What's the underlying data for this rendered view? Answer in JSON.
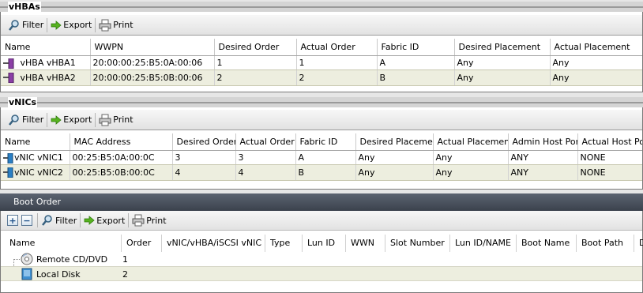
{
  "vhbas": {
    "title": "vHBAs",
    "toolbar": {
      "filter": "Filter",
      "export": "Export",
      "print": "Print"
    },
    "columns": [
      "Name",
      "WWPN",
      "Desired Order",
      "Actual Order",
      "Fabric ID",
      "Desired Placement",
      "Actual Placement"
    ],
    "rows": [
      [
        "vHBA vHBA1",
        "20:00:00:25:B5:0A:00:06",
        "1",
        "1",
        "A",
        "Any",
        "Any"
      ],
      [
        "vHBA vHBA2",
        "20:00:00:25:B5:0B:00:06",
        "2",
        "2",
        "B",
        "Any",
        "Any"
      ]
    ]
  },
  "vnics": {
    "title": "vNICs",
    "toolbar": {
      "filter": "Filter",
      "export": "Export",
      "print": "Print"
    },
    "columns": [
      "Name",
      "MAC Address",
      "Desired Order",
      "Actual Order",
      "Fabric ID",
      "Desired Placement",
      "Actual Placement",
      "Admin Host Port",
      "Actual Host Por"
    ],
    "rows": [
      [
        "vNIC vNIC1",
        "00:25:B5:0A:00:0C",
        "3",
        "3",
        "A",
        "Any",
        "Any",
        "ANY",
        "NONE"
      ],
      [
        "vNIC vNIC2",
        "00:25:B5:0B:00:0C",
        "4",
        "4",
        "B",
        "Any",
        "Any",
        "ANY",
        "NONE"
      ]
    ]
  },
  "boot_order": {
    "title": "Boot Order",
    "toolbar": {
      "add": "+",
      "remove": "−",
      "filter": "Filter",
      "export": "Export",
      "print": "Print"
    },
    "columns": [
      "Name",
      "Order",
      "vNIC/vHBA/iSCSI vNIC",
      "Type",
      "Lun ID",
      "WWN",
      "Slot Number",
      "Lun ID/NAME",
      "Boot Name",
      "Boot Path",
      "D"
    ],
    "rows": [
      {
        "name": "Remote CD/DVD",
        "order": "1",
        "icon": "cd-dvd-icon"
      },
      {
        "name": "Local Disk",
        "order": "2",
        "icon": "local-disk-icon"
      }
    ]
  },
  "colors": {
    "row_alt": "#edeedf",
    "boot_header": "#4a525e",
    "hba_icon": "#8b3fa6",
    "nic_icon": "#2a7fc4"
  }
}
